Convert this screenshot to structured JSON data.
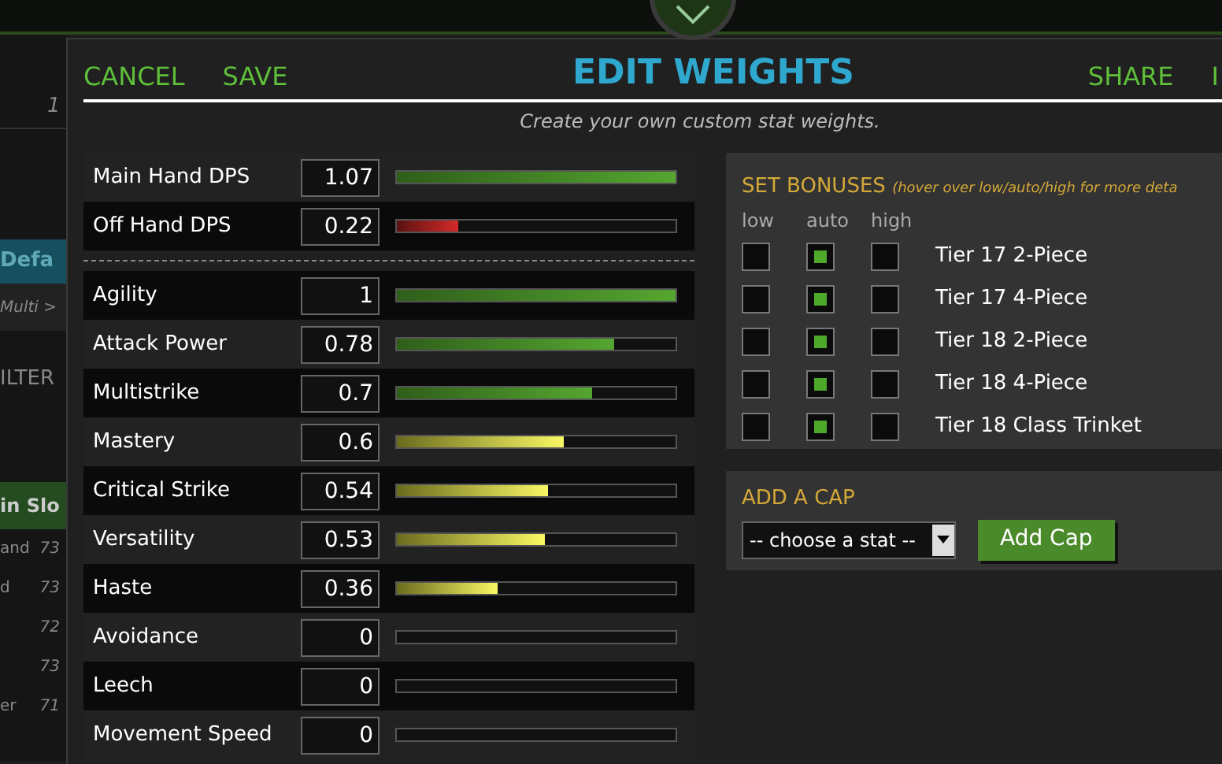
{
  "background_page": {
    "items": [
      {
        "kind": "count",
        "text": "1"
      },
      {
        "kind": "tab",
        "text": "Defa"
      },
      {
        "kind": "crumb",
        "text": "Multi > "
      },
      {
        "kind": "label",
        "text": "ILTER"
      },
      {
        "kind": "heading",
        "text": "in Slo"
      },
      {
        "kind": "row",
        "text": "and",
        "value": "73"
      },
      {
        "kind": "row",
        "text": "d",
        "value": "73"
      },
      {
        "kind": "row",
        "value": "72"
      },
      {
        "kind": "row",
        "value": "73"
      },
      {
        "kind": "row",
        "text": "er",
        "value": "71"
      }
    ]
  },
  "dialog": {
    "actions_left": [
      "CANCEL",
      "SAVE"
    ],
    "title": "EDIT WEIGHTS",
    "actions_right": [
      "SHARE",
      "I"
    ],
    "subtitle": "Create your own custom stat weights.",
    "weapon_stats": [
      {
        "name": "Main Hand DPS",
        "value": "1.07",
        "level": 1
      },
      {
        "name": "Off Hand DPS",
        "value": "0.22",
        "level": 0.22
      }
    ],
    "stats": [
      {
        "name": "Agility",
        "value": "1",
        "level": 1
      },
      {
        "name": "Attack Power",
        "value": "0.78",
        "level": 0.78
      },
      {
        "name": "Multistrike",
        "value": "0.7",
        "level": 0.7
      },
      {
        "name": "Mastery",
        "value": "0.6",
        "level": 0.6
      },
      {
        "name": "Critical Strike",
        "value": "0.54",
        "level": 0.54
      },
      {
        "name": "Versatility",
        "value": "0.53",
        "level": 0.53
      },
      {
        "name": "Haste",
        "value": "0.36",
        "level": 0.36
      },
      {
        "name": "Avoidance",
        "value": "0"
      },
      {
        "name": "Leech",
        "value": "0"
      },
      {
        "name": "Movement Speed",
        "value": "0"
      }
    ],
    "set_bonuses": {
      "title": "SET BONUSES",
      "hint": "(hover over low/auto/high for more deta",
      "columns": [
        "low",
        "auto",
        "high"
      ],
      "rows": [
        {
          "name": "Tier 17 2-Piece",
          "options": [
            {
              "selected": false
            },
            {
              "selected": true
            },
            {
              "selected": false
            }
          ]
        },
        {
          "name": "Tier 17 4-Piece",
          "options": [
            {
              "selected": false
            },
            {
              "selected": true
            },
            {
              "selected": false
            }
          ]
        },
        {
          "name": "Tier 18 2-Piece",
          "options": [
            {
              "selected": false
            },
            {
              "selected": true
            },
            {
              "selected": false
            }
          ]
        },
        {
          "name": "Tier 18 4-Piece",
          "options": [
            {
              "selected": false
            },
            {
              "selected": true
            },
            {
              "selected": false
            }
          ]
        },
        {
          "name": "Tier 18 Class Trinket",
          "options": [
            {
              "selected": false
            },
            {
              "selected": true
            },
            {
              "selected": false
            }
          ]
        }
      ]
    },
    "add_cap": {
      "title": "ADD A CAP",
      "select": "-- choose a stat --",
      "button": "Add Cap"
    }
  }
}
